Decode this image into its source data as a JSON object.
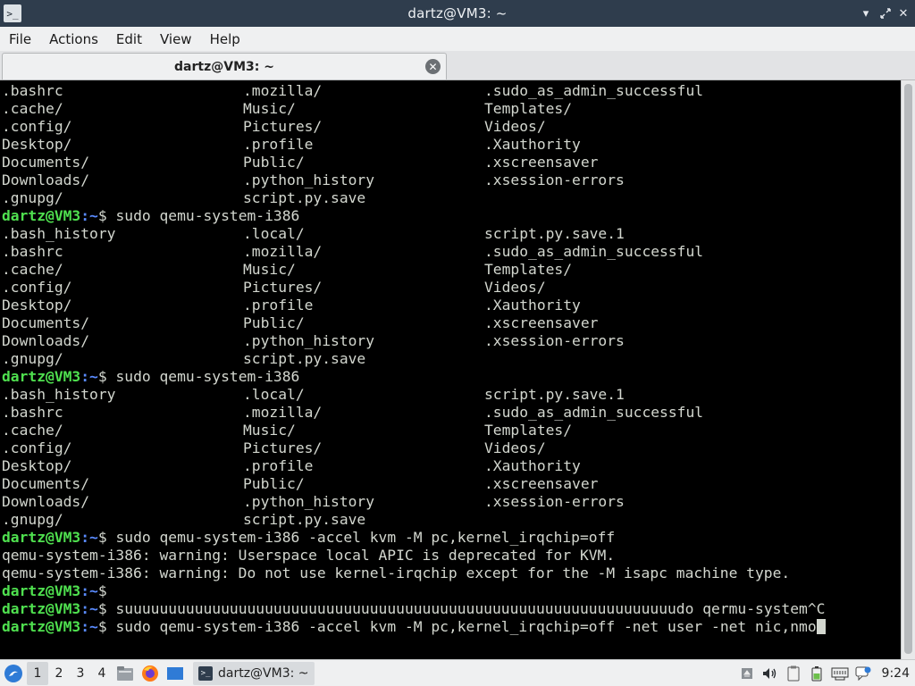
{
  "window": {
    "title": "dartz@VM3: ~",
    "icon": "terminal-icon",
    "controls": [
      "minimize-icon",
      "restore-icon",
      "close-icon"
    ]
  },
  "menubar": {
    "items": [
      "File",
      "Actions",
      "Edit",
      "View",
      "Help"
    ]
  },
  "tabs": [
    {
      "label": "dartz@VM3: ~",
      "active": true
    }
  ],
  "terminal": {
    "lines": [
      {
        "type": "cols",
        "cols": [
          ".bashrc",
          ".mozilla/",
          ".sudo_as_admin_successful"
        ]
      },
      {
        "type": "cols",
        "cols": [
          ".cache/",
          "Music/",
          "Templates/"
        ]
      },
      {
        "type": "cols",
        "cols": [
          ".config/",
          "Pictures/",
          "Videos/"
        ]
      },
      {
        "type": "cols",
        "cols": [
          "Desktop/",
          ".profile",
          ".Xauthority"
        ]
      },
      {
        "type": "cols",
        "cols": [
          "Documents/",
          "Public/",
          ".xscreensaver"
        ]
      },
      {
        "type": "cols",
        "cols": [
          "Downloads/",
          ".python_history",
          ".xsession-errors"
        ]
      },
      {
        "type": "cols",
        "cols": [
          ".gnupg/",
          "script.py.save",
          ""
        ]
      },
      {
        "type": "prompt",
        "user": "dartz@VM3",
        "path": "~",
        "cmd": " sudo qemu-system-i386"
      },
      {
        "type": "cols",
        "cols": [
          ".bash_history",
          ".local/",
          "script.py.save.1"
        ]
      },
      {
        "type": "cols",
        "cols": [
          ".bashrc",
          ".mozilla/",
          ".sudo_as_admin_successful"
        ]
      },
      {
        "type": "cols",
        "cols": [
          ".cache/",
          "Music/",
          "Templates/"
        ]
      },
      {
        "type": "cols",
        "cols": [
          ".config/",
          "Pictures/",
          "Videos/"
        ]
      },
      {
        "type": "cols",
        "cols": [
          "Desktop/",
          ".profile",
          ".Xauthority"
        ]
      },
      {
        "type": "cols",
        "cols": [
          "Documents/",
          "Public/",
          ".xscreensaver"
        ]
      },
      {
        "type": "cols",
        "cols": [
          "Downloads/",
          ".python_history",
          ".xsession-errors"
        ]
      },
      {
        "type": "cols",
        "cols": [
          ".gnupg/",
          "script.py.save",
          ""
        ]
      },
      {
        "type": "prompt",
        "user": "dartz@VM3",
        "path": "~",
        "cmd": " sudo qemu-system-i386"
      },
      {
        "type": "cols",
        "cols": [
          ".bash_history",
          ".local/",
          "script.py.save.1"
        ]
      },
      {
        "type": "cols",
        "cols": [
          ".bashrc",
          ".mozilla/",
          ".sudo_as_admin_successful"
        ]
      },
      {
        "type": "cols",
        "cols": [
          ".cache/",
          "Music/",
          "Templates/"
        ]
      },
      {
        "type": "cols",
        "cols": [
          ".config/",
          "Pictures/",
          "Videos/"
        ]
      },
      {
        "type": "cols",
        "cols": [
          "Desktop/",
          ".profile",
          ".Xauthority"
        ]
      },
      {
        "type": "cols",
        "cols": [
          "Documents/",
          "Public/",
          ".xscreensaver"
        ]
      },
      {
        "type": "cols",
        "cols": [
          "Downloads/",
          ".python_history",
          ".xsession-errors"
        ]
      },
      {
        "type": "cols",
        "cols": [
          ".gnupg/",
          "script.py.save",
          ""
        ]
      },
      {
        "type": "prompt",
        "user": "dartz@VM3",
        "path": "~",
        "cmd": " sudo qemu-system-i386 -accel kvm -M pc,kernel_irqchip=off"
      },
      {
        "type": "text",
        "text": "qemu-system-i386: warning: Userspace local APIC is deprecated for KVM."
      },
      {
        "type": "text",
        "text": "qemu-system-i386: warning: Do not use kernel-irqchip except for the -M isapc machine type."
      },
      {
        "type": "prompt",
        "user": "dartz@VM3",
        "path": "~",
        "cmd": ""
      },
      {
        "type": "prompt",
        "user": "dartz@VM3",
        "path": "~",
        "cmd": " suuuuuuuuuuuuuuuuuuuuuuuuuuuuuuuuuuuuuuuuuuuuuuuuuuuuuuuuuuuuuuudo qermu-system^C"
      },
      {
        "type": "prompt",
        "user": "dartz@VM3",
        "path": "~",
        "cmd": " sudo qemu-system-i386 -accel kvm -M pc,kernel_irqchip=off -net user -net nic,nmo",
        "cursor": true
      }
    ]
  },
  "taskbar": {
    "start_icon": "lubuntu-start-icon",
    "workspaces": [
      "1",
      "2",
      "3",
      "4"
    ],
    "active_workspace": "1",
    "quicklaunch": [
      "file-manager-icon",
      "firefox-icon",
      "show-desktop-icon"
    ],
    "task": {
      "label": "dartz@VM3: ~",
      "icon": "terminal-icon"
    },
    "tray": [
      "eject-icon",
      "volume-icon",
      "clipboard-icon",
      "battery-icon",
      "network-icon",
      "notification-icon"
    ],
    "clock": "9:24"
  },
  "colors": {
    "titlebar": "#2f3d4d",
    "prompt_user": "#4fe04f",
    "prompt_path": "#5a8bff",
    "terminal_bg": "#000000",
    "terminal_fg": "#d3d7cf"
  }
}
